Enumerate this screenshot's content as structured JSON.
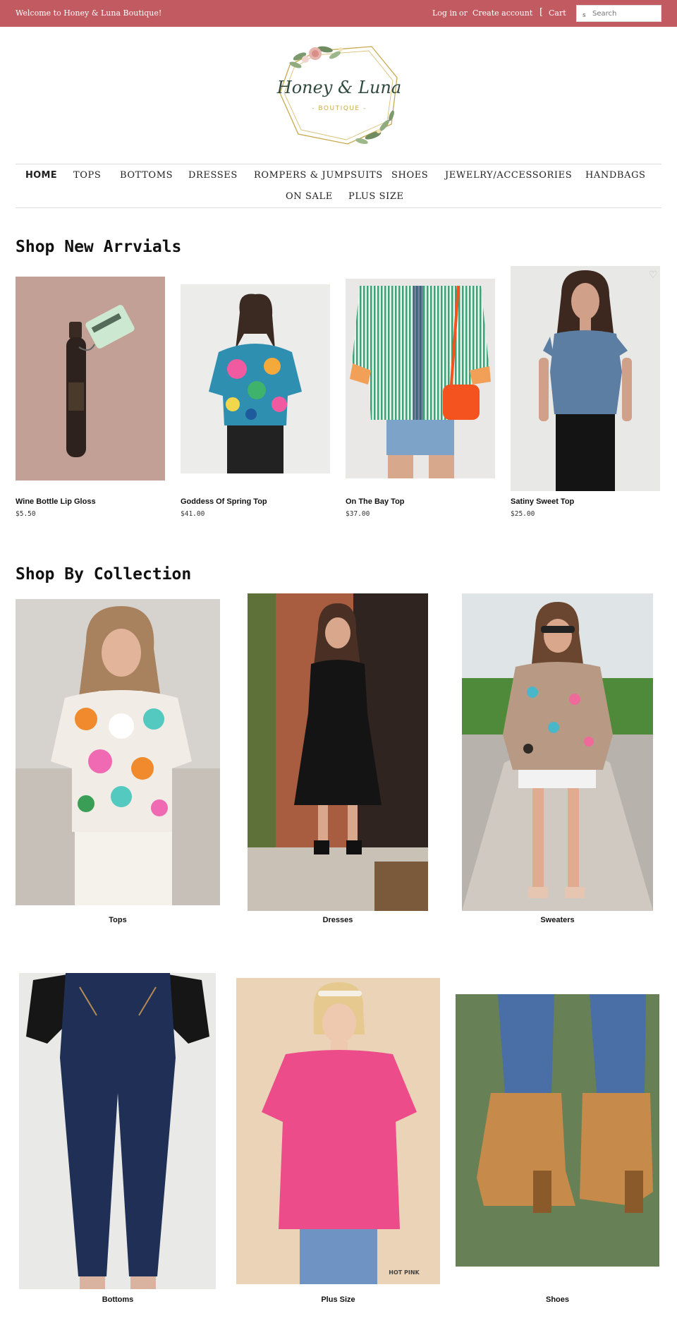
{
  "topbar": {
    "welcome": "Welcome to Honey & Luna Boutique!",
    "login": "Log in",
    "or": "or",
    "create_account": "Create account",
    "cart_icon": "[",
    "cart": "Cart",
    "search_icon": "s",
    "search_placeholder": "Search"
  },
  "logo": {
    "brand_main": "Honey & Luna",
    "brand_sub": "- BOUTIQUE -"
  },
  "nav": {
    "items": [
      "HOME",
      "TOPS",
      "BOTTOMS",
      "DRESSES",
      "ROMPERS & JUMPSUITS",
      "SHOES",
      "JEWELRY/ACCESSORIES",
      "HANDBAGS",
      "ON SALE",
      "PLUS SIZE"
    ]
  },
  "new_arrivals": {
    "title": "Shop New Arrvials",
    "products": [
      {
        "name": "Wine Bottle Lip Gloss",
        "price": "$5.50"
      },
      {
        "name": "Goddess Of Spring Top",
        "price": "$41.00"
      },
      {
        "name": "On The Bay Top",
        "price": "$37.00"
      },
      {
        "name": "Satiny Sweet Top",
        "price": "$25.00"
      }
    ],
    "wishlist_icon": "♡"
  },
  "collections": {
    "title": "Shop By Collection",
    "items": [
      {
        "label": "Tops"
      },
      {
        "label": "Dresses"
      },
      {
        "label": "Sweaters"
      },
      {
        "label": "Bottoms"
      },
      {
        "label": "Plus Size"
      },
      {
        "label": "Shoes"
      }
    ],
    "watermark": "HOT PINK"
  },
  "colors": {
    "topbar": "#c25a61",
    "text": "#222222"
  }
}
